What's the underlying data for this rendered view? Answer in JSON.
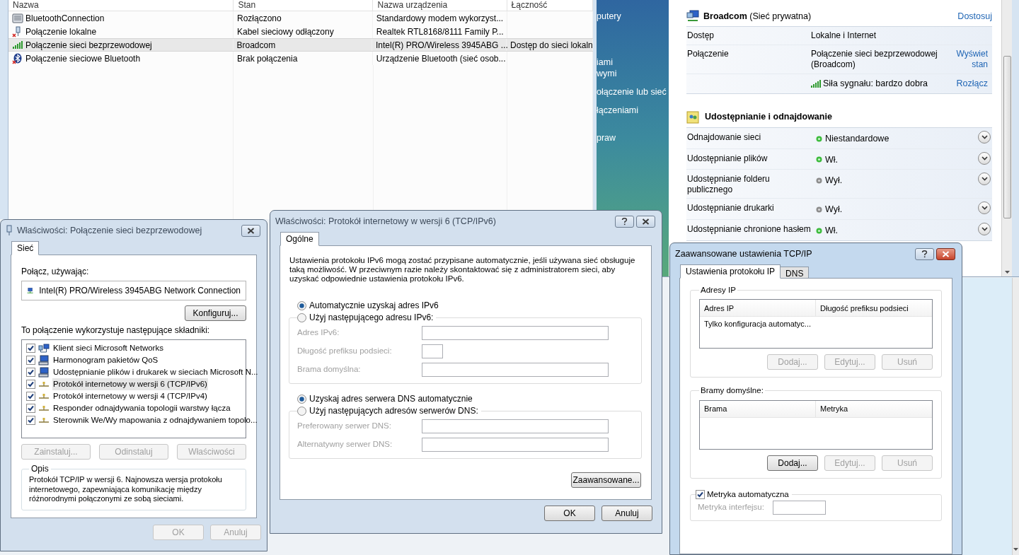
{
  "connections": {
    "columns": [
      "Nazwa",
      "Stan",
      "Nazwa urządzenia",
      "Łączność"
    ],
    "rows": [
      {
        "kind": "modem",
        "name": "BluetoothConnection",
        "status": "Rozłączono",
        "device": "Standardowy modem wykorzyst...",
        "selected": false
      },
      {
        "kind": "lan",
        "name": "Połączenie lokalne",
        "status": "Kabel sieciowy odłączony",
        "device": "Realtek RTL8168/8111 Family P...",
        "selected": false
      },
      {
        "kind": "wifi",
        "name": "Połączenie sieci bezprzewodowej",
        "status": "Broadcom",
        "device": "Intel(R) PRO/Wireless 3945ABG ...",
        "connectivity": "Dostęp do sieci lokaln",
        "selected": true
      },
      {
        "kind": "bluetooth",
        "name": "Połączenie sieciowe Bluetooth",
        "status": "Brak połączenia",
        "device": "Urządzenie Bluetooth (sieć osob...",
        "selected": false
      }
    ]
  },
  "network_center": {
    "sidebar_links": [
      [
        "putery"
      ],
      [
        "iami",
        "wymi"
      ],
      [
        "ołączenie lub sieć"
      ],
      [
        "łączeniami"
      ],
      [
        "praw"
      ]
    ],
    "network": {
      "name": "Broadcom",
      "type": "(Sieć prywatna)",
      "link": "Dostosuj"
    },
    "details": [
      {
        "label": "Dostęp",
        "value": "Lokalne i Internet"
      },
      {
        "label": "Połączenie",
        "value": "Połączenie sieci bezprzewodowej (Broadcom)",
        "link": "Wyświet stan"
      }
    ],
    "signal": {
      "text": "Siła sygnału: bardzo dobra",
      "link": "Rozłącz"
    },
    "sharing": {
      "title": "Udostępnianie i odnajdowanie",
      "items": [
        {
          "label": "Odnajdowanie sieci",
          "status": "Niestandardowe",
          "on": true
        },
        {
          "label": "Udostępnianie plików",
          "status": "Wł.",
          "on": true
        },
        {
          "label": "Udostępnianie folderu publicznego",
          "status": "Wył.",
          "on": false
        },
        {
          "label": "Udostępnianie drukarki",
          "status": "Wył.",
          "on": false
        },
        {
          "label": "Udostępnianie chronione hasłem",
          "status": "Wł.",
          "on": true
        }
      ]
    }
  },
  "properties_dialog": {
    "title": "Właściwości: Połączenie sieci bezprzewodowej",
    "active": false,
    "tabs": [
      {
        "label": "Sieć",
        "selected": true
      }
    ],
    "connect_using_label": "Połącz, używając:",
    "adapter": "Intel(R) PRO/Wireless 3945ABG Network Connection",
    "configure_button": {
      "label": "Konfiguruj...",
      "disabled": false
    },
    "components_label": "To połączenie wykorzystuje następujące składniki:",
    "components": [
      {
        "kind": "client",
        "label": "Klient sieci Microsoft Networks",
        "checked": true,
        "selected": false
      },
      {
        "kind": "computer",
        "label": "Harmonogram pakietów QoS",
        "checked": true,
        "selected": false
      },
      {
        "kind": "computer",
        "label": "Udostępnianie plików i drukarek w sieciach Microsoft N...",
        "checked": true,
        "selected": false
      },
      {
        "kind": "protocol",
        "label": "Protokół internetowy w wersji 6 (TCP/IPv6)",
        "checked": true,
        "selected": true
      },
      {
        "kind": "protocol",
        "label": "Protokół internetowy w wersji 4 (TCP/IPv4)",
        "checked": true,
        "selected": false
      },
      {
        "kind": "protocol",
        "label": "Responder odnajdywania topologii warstwy łącza",
        "checked": true,
        "selected": false
      },
      {
        "kind": "protocol",
        "label": "Sterownik We/Wy mapowania z odnajdywaniem topolo...",
        "checked": true,
        "selected": false
      }
    ],
    "buttons": [
      {
        "label": "Zainstaluj...",
        "disabled": true
      },
      {
        "label": "Odinstaluj",
        "disabled": true
      },
      {
        "label": "Właściwości",
        "disabled": true
      }
    ],
    "description": {
      "title": "Opis",
      "text": "Protokół TCP/IP w wersji 6. Najnowsza wersja protokołu internetowego, zapewniająca komunikację między różnorodnymi połączonymi ze sobą sieciami."
    },
    "footer_buttons": [
      {
        "label": "OK",
        "disabled": true
      },
      {
        "label": "Anuluj",
        "disabled": true
      }
    ]
  },
  "ipv6_dialog": {
    "title": "Właściwości: Protokół internetowy w wersji 6 (TCP/IPv6)",
    "active": false,
    "tabs": [
      {
        "label": "Ogólne",
        "selected": true
      }
    ],
    "intro": "Ustawienia protokołu IPv6 mogą zostać przypisane automatycznie, jeśli używana sieć obsługuje taką możliwość. W przeciwnym razie należy skontaktować się z administratorem sieci, aby uzyskać odpowiednie ustawienia protokołu IPv6.",
    "option_groups": [
      [
        {
          "label": "Automatycznie uzyskaj adres IPv6",
          "selected": true
        },
        {
          "label": "Użyj następującego adresu IPv6:",
          "selected": false,
          "fields": [
            {
              "label": "Adres IPv6:",
              "kind": "wide"
            },
            {
              "label": "Długość prefiksu podsieci:",
              "kind": "short"
            },
            {
              "label": "Brama domyślna:",
              "kind": "wide"
            }
          ]
        }
      ],
      [
        {
          "label": "Uzyskaj adres serwera DNS automatycznie",
          "selected": true
        },
        {
          "label": "Użyj następujących adresów serwerów DNS:",
          "selected": false,
          "fields": [
            {
              "label": "Preferowany serwer DNS:",
              "kind": "wide"
            },
            {
              "label": "Alternatywny serwer DNS:",
              "kind": "wide"
            }
          ]
        }
      ]
    ],
    "advanced_button": {
      "label": "Zaawansowane...",
      "disabled": false
    },
    "footer_buttons": [
      {
        "label": "OK",
        "disabled": false
      },
      {
        "label": "Anuluj",
        "disabled": false
      }
    ]
  },
  "advanced_dialog": {
    "title": "Zaawansowane ustawienia TCP/IP",
    "active": true,
    "tabs": [
      {
        "label": "Ustawienia protokołu IP",
        "selected": true
      },
      {
        "label": "DNS",
        "selected": false
      }
    ],
    "groups": [
      {
        "title": "Adresy IP",
        "columns": [
          "Adres IP",
          "Długość prefiksu podsieci"
        ],
        "rows": [
          [
            "Tylko konfiguracja automatyc..."
          ]
        ],
        "buttons": [
          {
            "label": "Dodaj...",
            "disabled": true
          },
          {
            "label": "Edytuj...",
            "disabled": true
          },
          {
            "label": "Usuń",
            "disabled": true
          }
        ]
      },
      {
        "title": "Bramy domyślne:",
        "columns": [
          "Brama",
          "Metryka"
        ],
        "buttons": [
          {
            "label": "Dodaj...",
            "disabled": false
          },
          {
            "label": "Edytuj...",
            "disabled": true
          },
          {
            "label": "Usuń",
            "disabled": true
          }
        ]
      }
    ],
    "metric": {
      "label": "Metryka automatyczna",
      "checked": true,
      "field_label": "Metryka interfejsu:"
    }
  }
}
